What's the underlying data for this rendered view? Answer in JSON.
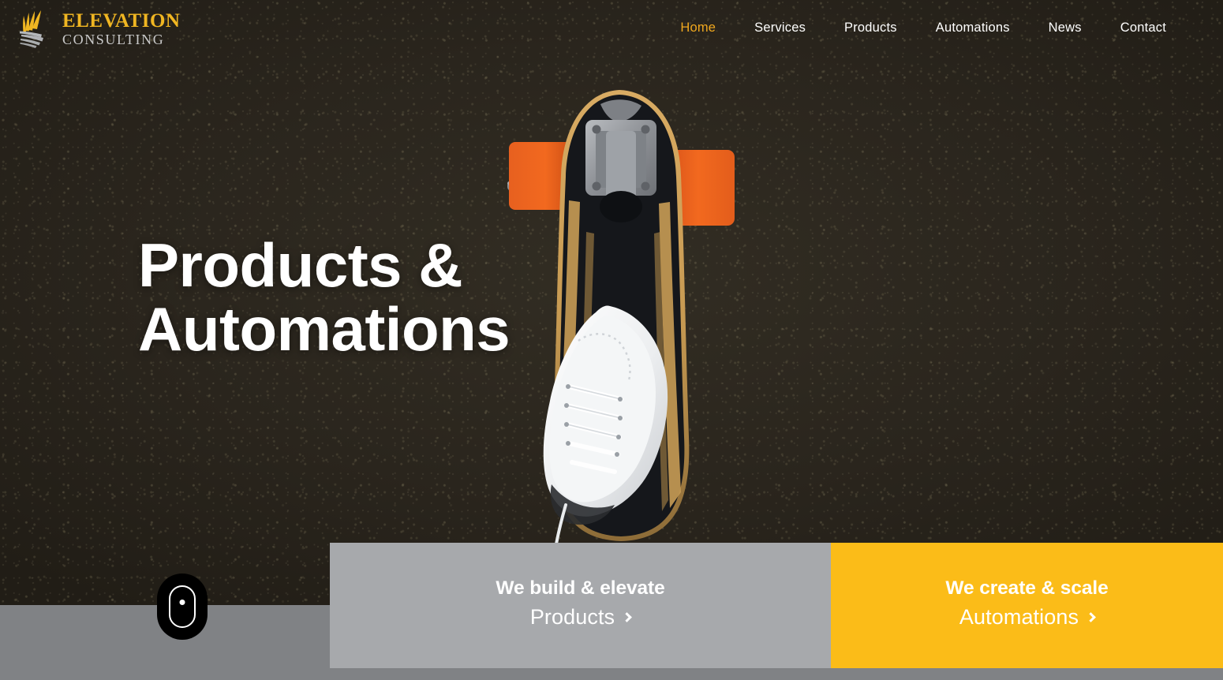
{
  "brand": {
    "name_top": "ELEVATION",
    "name_bottom": "CONSULTING",
    "logo_icon": "wing-feather-icon",
    "gold": "#f0b622",
    "silver": "#c9c9c9"
  },
  "nav": {
    "items": [
      {
        "label": "Home",
        "active": true
      },
      {
        "label": "Services",
        "active": false
      },
      {
        "label": "Products",
        "active": false
      },
      {
        "label": "Automations",
        "active": false
      },
      {
        "label": "News",
        "active": false
      },
      {
        "label": "Contact",
        "active": false
      }
    ],
    "active_color": "#f0a81e",
    "color": "#ffffff"
  },
  "hero": {
    "headline_line1": "Products &",
    "headline_line2": "Automations",
    "image_subject": "top-down view of a longboard skateboard with orange wheels and a white high-top sneaker on asphalt",
    "background_color": "#2a261e"
  },
  "scroll_indicator": {
    "icon": "scroll-mouse-icon",
    "background": "#000000",
    "stroke": "#ffffff"
  },
  "cards": [
    {
      "title": "We build & elevate",
      "link_label": "Products",
      "arrow_icon": "chevron-right-icon",
      "background": "#a7a9ac"
    },
    {
      "title": "We create & scale",
      "link_label": "Automations",
      "arrow_icon": "chevron-right-icon",
      "background": "#fbbc18"
    }
  ],
  "band": {
    "color": "#808285"
  }
}
